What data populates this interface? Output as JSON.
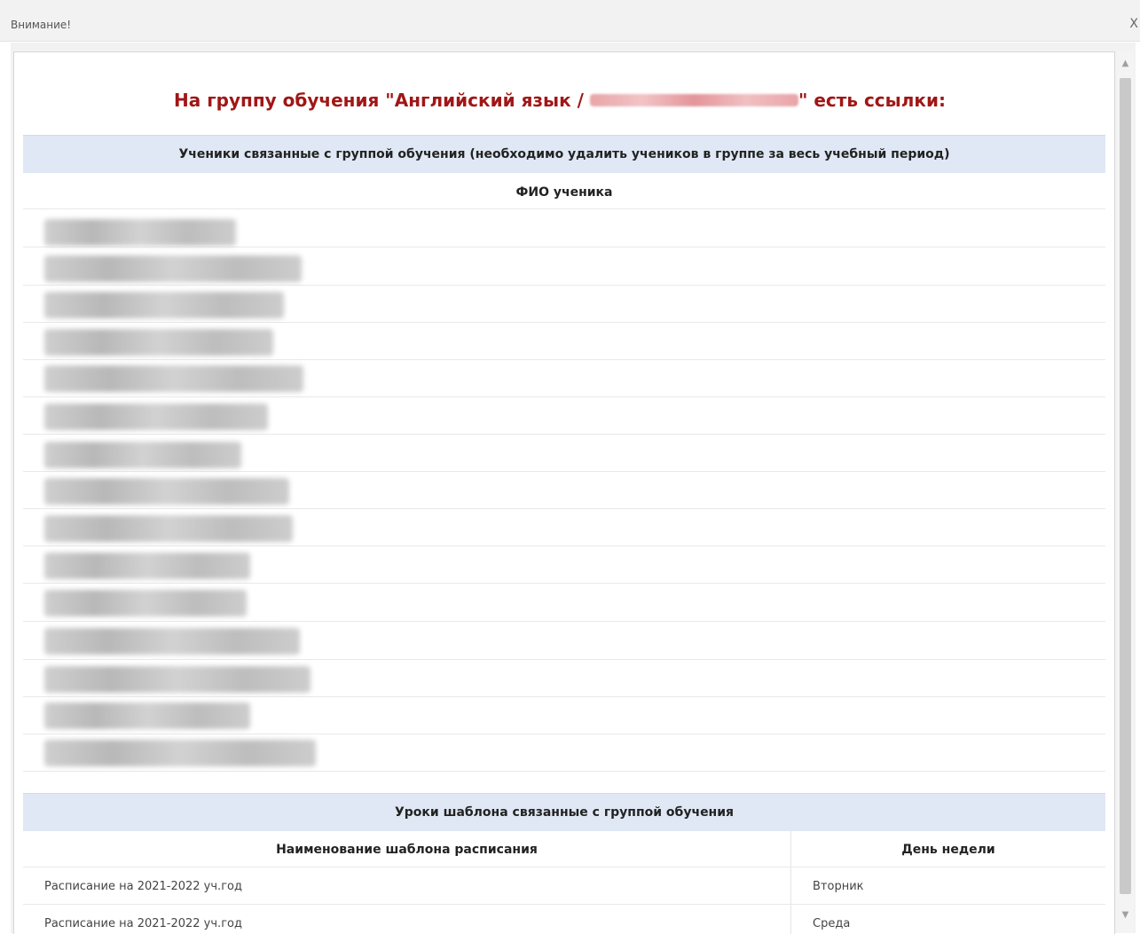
{
  "window": {
    "title": "Внимание!",
    "close_label": "X"
  },
  "heading": {
    "prefix": "На группу обучения \"Английский язык / ",
    "suffix": "\" есть ссылки:"
  },
  "students_section": {
    "title": "Ученики связанные с группой обучения (необходимо удалить учеников в группе за весь учебный период)",
    "column_header": "ФИО ученика"
  },
  "lessons_section": {
    "title": "Уроки шаблона связанные с группой обучения",
    "columns": [
      "Наименование шаблона расписания",
      "День недели"
    ],
    "rows": [
      {
        "template": "Расписание на 2021-2022 уч.год",
        "day": "Вторник"
      },
      {
        "template": "Расписание на 2021-2022 уч.год",
        "day": "Среда"
      }
    ]
  }
}
